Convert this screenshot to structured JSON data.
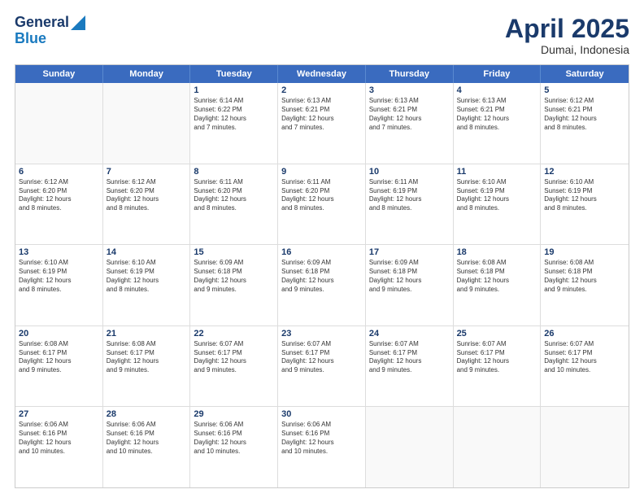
{
  "header": {
    "logo_line1": "General",
    "logo_line2": "Blue",
    "month": "April 2025",
    "location": "Dumai, Indonesia"
  },
  "days_of_week": [
    "Sunday",
    "Monday",
    "Tuesday",
    "Wednesday",
    "Thursday",
    "Friday",
    "Saturday"
  ],
  "weeks": [
    [
      {
        "day": "",
        "empty": true
      },
      {
        "day": "",
        "empty": true
      },
      {
        "day": "1",
        "sunrise": "6:14 AM",
        "sunset": "6:22 PM",
        "daylight": "12 hours and 7 minutes."
      },
      {
        "day": "2",
        "sunrise": "6:13 AM",
        "sunset": "6:21 PM",
        "daylight": "12 hours and 7 minutes."
      },
      {
        "day": "3",
        "sunrise": "6:13 AM",
        "sunset": "6:21 PM",
        "daylight": "12 hours and 7 minutes."
      },
      {
        "day": "4",
        "sunrise": "6:13 AM",
        "sunset": "6:21 PM",
        "daylight": "12 hours and 8 minutes."
      },
      {
        "day": "5",
        "sunrise": "6:12 AM",
        "sunset": "6:21 PM",
        "daylight": "12 hours and 8 minutes."
      }
    ],
    [
      {
        "day": "6",
        "sunrise": "6:12 AM",
        "sunset": "6:20 PM",
        "daylight": "12 hours and 8 minutes."
      },
      {
        "day": "7",
        "sunrise": "6:12 AM",
        "sunset": "6:20 PM",
        "daylight": "12 hours and 8 minutes."
      },
      {
        "day": "8",
        "sunrise": "6:11 AM",
        "sunset": "6:20 PM",
        "daylight": "12 hours and 8 minutes."
      },
      {
        "day": "9",
        "sunrise": "6:11 AM",
        "sunset": "6:20 PM",
        "daylight": "12 hours and 8 minutes."
      },
      {
        "day": "10",
        "sunrise": "6:11 AM",
        "sunset": "6:19 PM",
        "daylight": "12 hours and 8 minutes."
      },
      {
        "day": "11",
        "sunrise": "6:10 AM",
        "sunset": "6:19 PM",
        "daylight": "12 hours and 8 minutes."
      },
      {
        "day": "12",
        "sunrise": "6:10 AM",
        "sunset": "6:19 PM",
        "daylight": "12 hours and 8 minutes."
      }
    ],
    [
      {
        "day": "13",
        "sunrise": "6:10 AM",
        "sunset": "6:19 PM",
        "daylight": "12 hours and 8 minutes."
      },
      {
        "day": "14",
        "sunrise": "6:10 AM",
        "sunset": "6:19 PM",
        "daylight": "12 hours and 8 minutes."
      },
      {
        "day": "15",
        "sunrise": "6:09 AM",
        "sunset": "6:18 PM",
        "daylight": "12 hours and 9 minutes."
      },
      {
        "day": "16",
        "sunrise": "6:09 AM",
        "sunset": "6:18 PM",
        "daylight": "12 hours and 9 minutes."
      },
      {
        "day": "17",
        "sunrise": "6:09 AM",
        "sunset": "6:18 PM",
        "daylight": "12 hours and 9 minutes."
      },
      {
        "day": "18",
        "sunrise": "6:08 AM",
        "sunset": "6:18 PM",
        "daylight": "12 hours and 9 minutes."
      },
      {
        "day": "19",
        "sunrise": "6:08 AM",
        "sunset": "6:18 PM",
        "daylight": "12 hours and 9 minutes."
      }
    ],
    [
      {
        "day": "20",
        "sunrise": "6:08 AM",
        "sunset": "6:17 PM",
        "daylight": "12 hours and 9 minutes."
      },
      {
        "day": "21",
        "sunrise": "6:08 AM",
        "sunset": "6:17 PM",
        "daylight": "12 hours and 9 minutes."
      },
      {
        "day": "22",
        "sunrise": "6:07 AM",
        "sunset": "6:17 PM",
        "daylight": "12 hours and 9 minutes."
      },
      {
        "day": "23",
        "sunrise": "6:07 AM",
        "sunset": "6:17 PM",
        "daylight": "12 hours and 9 minutes."
      },
      {
        "day": "24",
        "sunrise": "6:07 AM",
        "sunset": "6:17 PM",
        "daylight": "12 hours and 9 minutes."
      },
      {
        "day": "25",
        "sunrise": "6:07 AM",
        "sunset": "6:17 PM",
        "daylight": "12 hours and 9 minutes."
      },
      {
        "day": "26",
        "sunrise": "6:07 AM",
        "sunset": "6:17 PM",
        "daylight": "12 hours and 10 minutes."
      }
    ],
    [
      {
        "day": "27",
        "sunrise": "6:06 AM",
        "sunset": "6:16 PM",
        "daylight": "12 hours and 10 minutes."
      },
      {
        "day": "28",
        "sunrise": "6:06 AM",
        "sunset": "6:16 PM",
        "daylight": "12 hours and 10 minutes."
      },
      {
        "day": "29",
        "sunrise": "6:06 AM",
        "sunset": "6:16 PM",
        "daylight": "12 hours and 10 minutes."
      },
      {
        "day": "30",
        "sunrise": "6:06 AM",
        "sunset": "6:16 PM",
        "daylight": "12 hours and 10 minutes."
      },
      {
        "day": "",
        "empty": true
      },
      {
        "day": "",
        "empty": true
      },
      {
        "day": "",
        "empty": true
      }
    ]
  ]
}
